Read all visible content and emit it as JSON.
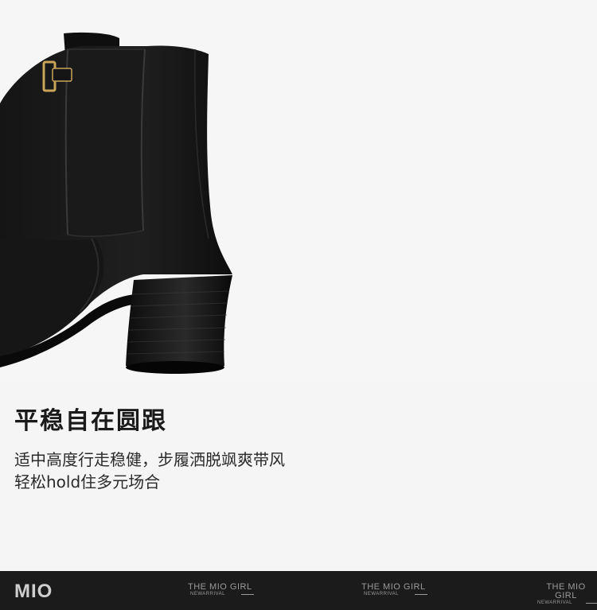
{
  "feature": {
    "title": "平稳自在圆跟",
    "description_lines": [
      "适中高度行走稳健，步履洒脱飒爽带风",
      "轻松hold住多元场合"
    ]
  },
  "footer": {
    "logo": "MIO",
    "watermarks": [
      {
        "title": "THE MIO GIRL",
        "subtitle": "NEWARRIVAL"
      },
      {
        "title": "THE MIO GIRL",
        "subtitle": "NEWARRIVAL"
      },
      {
        "title": "THE MIO GIRL",
        "subtitle": "NEWARRIVAL"
      }
    ]
  },
  "colors": {
    "background": "#f5f5f5",
    "footer": "#1b1b1b",
    "boot": "#121212",
    "buckle": "#c9a55a"
  }
}
